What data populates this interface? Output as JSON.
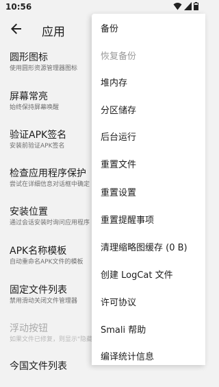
{
  "status_bar": {
    "time": "10:56"
  },
  "app_bar": {
    "title": "应用"
  },
  "settings": [
    {
      "title": "圆形图标",
      "subtitle": "使用圆形资源管理器图标",
      "enabled": true
    },
    {
      "title": "屏幕常亮",
      "subtitle": "始终保持屏幕唤醒",
      "enabled": true
    },
    {
      "title": "验证APK签名",
      "subtitle": "安装前验证APK签名",
      "enabled": true
    },
    {
      "title": "检查应用程序保护",
      "subtitle": "尝试在详细信息对话框中确定",
      "enabled": true
    },
    {
      "title": "安装位置",
      "subtitle": "通过会话安装时询问应用程序",
      "enabled": true
    },
    {
      "title": "APK名称模板",
      "subtitle": "自动重命名APK文件的模板",
      "enabled": true
    },
    {
      "title": "固定文件列表",
      "subtitle": "禁用滑动关闭文件管理器",
      "enabled": true
    },
    {
      "title": "浮动按钮",
      "subtitle": "如果文件已修复，则显示\"隐藏",
      "enabled": false
    },
    {
      "title": "今国文件列表",
      "subtitle": "",
      "enabled": true
    }
  ],
  "menu": [
    {
      "label": "备份",
      "enabled": true
    },
    {
      "label": "恢复备份",
      "enabled": false
    },
    {
      "label": "堆内存",
      "enabled": true
    },
    {
      "label": "分区储存",
      "enabled": true
    },
    {
      "label": "后台运行",
      "enabled": true
    },
    {
      "label": "重置文件",
      "enabled": true
    },
    {
      "label": "重置设置",
      "enabled": true
    },
    {
      "label": "重置提醒事项",
      "enabled": true
    },
    {
      "label": "清理缩略图缓存 (0 B)",
      "enabled": true
    },
    {
      "label": "创建 LogCat 文件",
      "enabled": true
    },
    {
      "label": "许可协议",
      "enabled": true
    },
    {
      "label": "Smali 帮助",
      "enabled": true
    },
    {
      "label": "编译统计信息",
      "enabled": true
    }
  ]
}
